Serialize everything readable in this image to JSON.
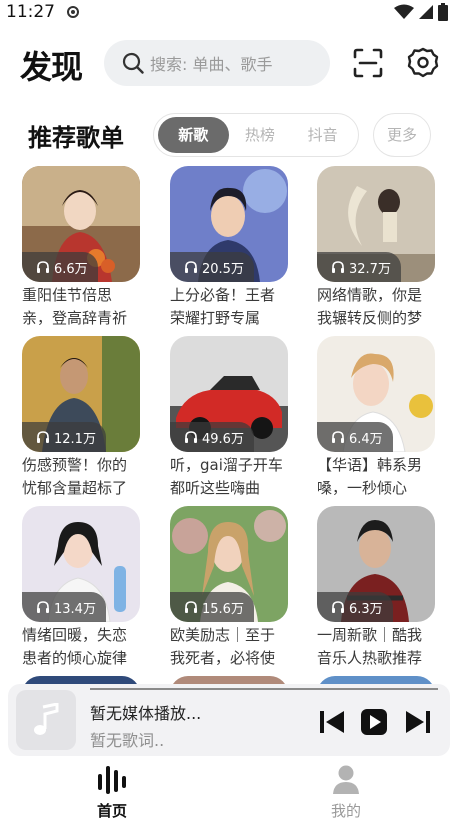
{
  "status": {
    "time": "11:27"
  },
  "header": {
    "title": "发现",
    "search_placeholder": "搜索: 单曲、歌手"
  },
  "section": {
    "title": "推荐歌单",
    "tabs": [
      {
        "label": "新歌",
        "active": true
      },
      {
        "label": "热榜",
        "active": false
      },
      {
        "label": "抖音",
        "active": false
      }
    ],
    "more_label": "更多"
  },
  "playlists": [
    {
      "plays": "6.6万",
      "title": "重阳佳节倍思亲，登高辞青祈"
    },
    {
      "plays": "20.5万",
      "title": "上分必备！王者荣耀打野专属"
    },
    {
      "plays": "32.7万",
      "title": "网络情歌，你是我辗转反侧的梦"
    },
    {
      "plays": "12.1万",
      "title": "伤感预警！你的忧郁含量超标了"
    },
    {
      "plays": "49.6万",
      "title": "听，gai溜子开车都听这些嗨曲"
    },
    {
      "plays": "6.4万",
      "title": "【华语】韩系男嗓，一秒倾心"
    },
    {
      "plays": "13.4万",
      "title": "情绪回暖，失恋患者的倾心旋律"
    },
    {
      "plays": "15.6万",
      "title": "欧美励志｜至于我死者，必将使"
    },
    {
      "plays": "6.3万",
      "title": "一周新歌｜酷我音乐人热歌推荐"
    }
  ],
  "player": {
    "title": "暂无媒体播放...",
    "lyric": "暂无歌词.."
  },
  "nav": {
    "home_label": "首页",
    "mine_label": "我的"
  },
  "colors": {
    "accent": "#222222",
    "tab_active_bg": "#6b6b6b",
    "player_bg": "#f2f2f4"
  },
  "icons": [
    "search-icon",
    "scan-icon",
    "settings-icon",
    "headphones-icon",
    "music-note-icon",
    "prev-icon",
    "play-icon",
    "next-icon",
    "home-bars-icon",
    "person-icon"
  ]
}
